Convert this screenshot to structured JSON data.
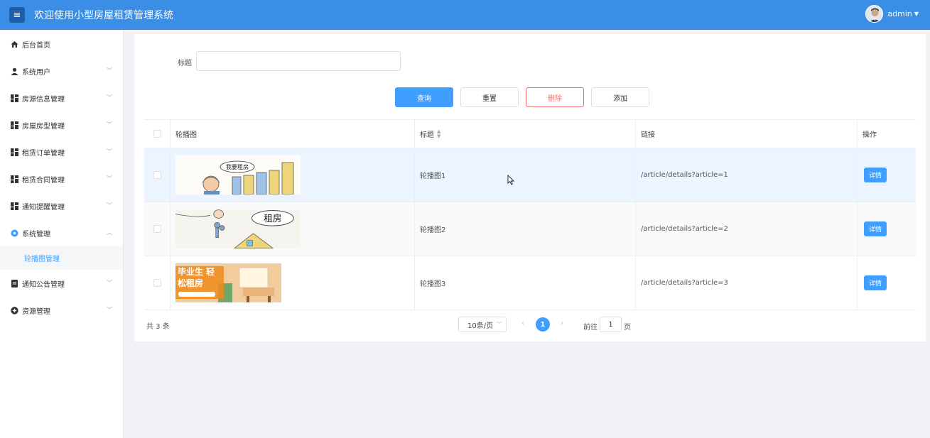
{
  "header": {
    "title": "欢迎使用小型房屋租赁管理系统",
    "username": "admin"
  },
  "sidebar": {
    "items": [
      {
        "label": "后台首页",
        "icon": "home-icon",
        "expandable": false
      },
      {
        "label": "系统用户",
        "icon": "user-icon",
        "expandable": true
      },
      {
        "label": "房源信息管理",
        "icon": "grid-icon",
        "expandable": true
      },
      {
        "label": "房屋房型管理",
        "icon": "grid-icon",
        "expandable": true
      },
      {
        "label": "租赁订单管理",
        "icon": "grid-icon",
        "expandable": true
      },
      {
        "label": "租赁合同管理",
        "icon": "grid-icon",
        "expandable": true
      },
      {
        "label": "通知提醒管理",
        "icon": "grid-icon",
        "expandable": true
      },
      {
        "label": "系统管理",
        "icon": "gear-icon",
        "expandable": true,
        "expanded": true
      },
      {
        "label": "通知公告管理",
        "icon": "document-icon",
        "expandable": true
      },
      {
        "label": "资源管理",
        "icon": "plus-circle-icon",
        "expandable": true
      }
    ],
    "active_sub": {
      "label": "轮播图管理"
    }
  },
  "filter": {
    "title_label": "标题",
    "title_value": ""
  },
  "buttons": {
    "query": "查询",
    "reset": "重置",
    "delete": "删除",
    "add": "添加"
  },
  "table": {
    "headers": {
      "image": "轮播图",
      "title": "标题",
      "link": "链接",
      "op": "操作"
    },
    "rows": [
      {
        "title": "轮播图1",
        "link": "/article/details?article=1",
        "detail": "详情",
        "image_desc": "我要租房"
      },
      {
        "title": "轮播图2",
        "link": "/article/details?article=2",
        "detail": "详情",
        "image_desc": "租房"
      },
      {
        "title": "轮播图3",
        "link": "/article/details?article=3",
        "detail": "详情",
        "image_desc": "毕业生 轻松租房"
      }
    ]
  },
  "pagination": {
    "total": "共 3 条",
    "page_size": "10条/页",
    "current_page": "1",
    "goto_label": "前往",
    "goto_value": "1",
    "page_label": "页"
  },
  "colors": {
    "header_bg": "#3a8ee6",
    "primary": "#409eff",
    "danger": "#f56c6c"
  }
}
